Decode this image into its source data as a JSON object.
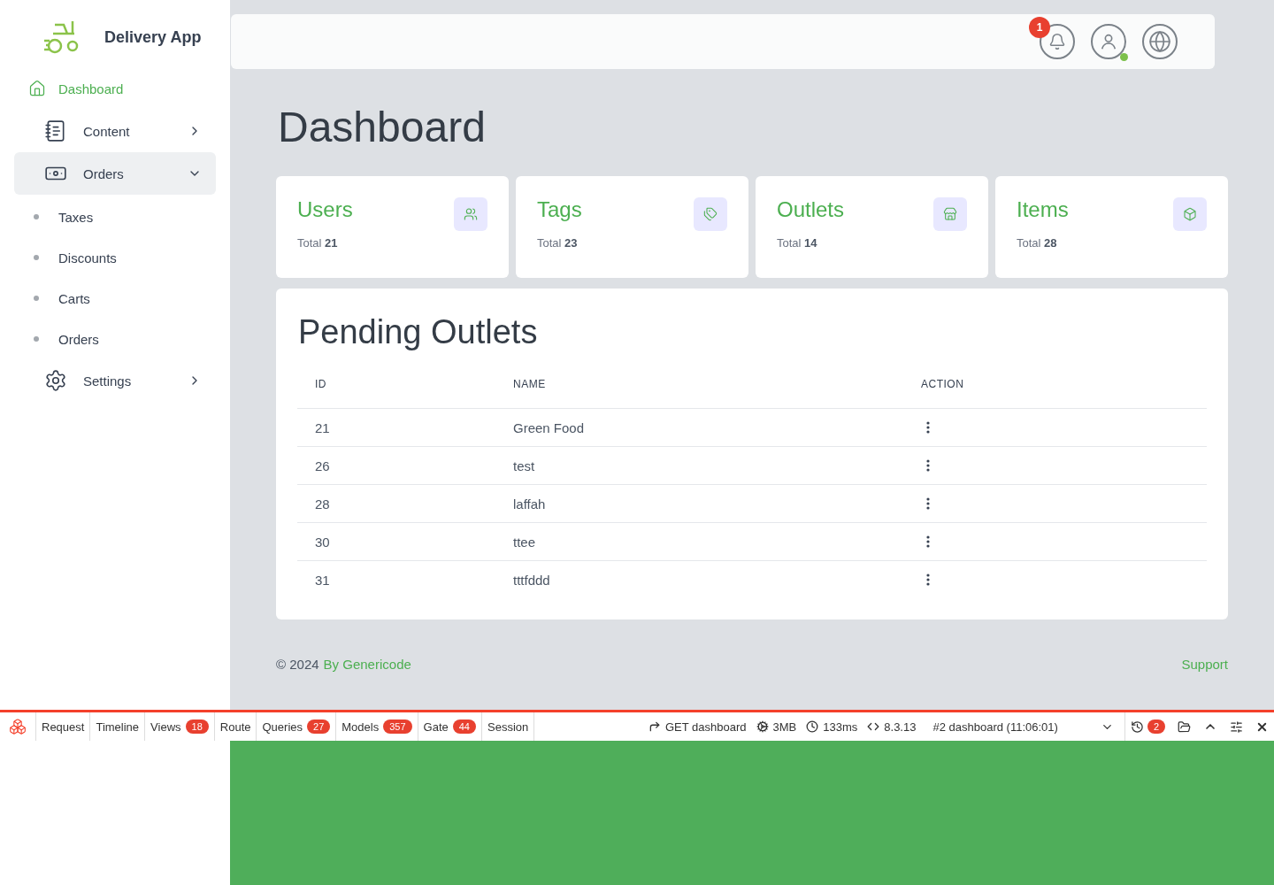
{
  "sidebar": {
    "brand": "Delivery App",
    "items": [
      {
        "kind": "link",
        "label": "Dashboard",
        "selected": true
      },
      {
        "kind": "group",
        "label": "Content",
        "selected": false,
        "expanded": false
      },
      {
        "kind": "group",
        "label": "Orders",
        "selected": false,
        "expanded": true,
        "children": [
          {
            "label": "Taxes",
            "selected": false
          },
          {
            "label": "Discounts",
            "selected": false
          },
          {
            "label": "Carts",
            "selected": false
          },
          {
            "label": "Orders",
            "selected": false
          }
        ]
      },
      {
        "kind": "group",
        "label": "Settings",
        "selected": false,
        "expanded": false
      }
    ]
  },
  "header": {
    "notification_count": "1",
    "user_online": true
  },
  "page_title": "Dashboard",
  "stats": [
    {
      "title": "Users",
      "total": "Total **21**"
    },
    {
      "title": "Tags",
      "total": "Total **23**"
    },
    {
      "title": "Outlets",
      "total": "Total **14**"
    },
    {
      "title": "Items",
      "total": "Total **28**"
    }
  ],
  "pending_outlets": {
    "title": "Pending Outlets",
    "columns": [
      "ID",
      "NAME",
      "ACTION"
    ],
    "rows": [
      {
        "id": "21",
        "name": "Green Food"
      },
      {
        "id": "26",
        "name": "test"
      },
      {
        "id": "28",
        "name": "laffah"
      },
      {
        "id": "30",
        "name": "ttee"
      },
      {
        "id": "31",
        "name": "tttfddd"
      }
    ]
  },
  "footer": {
    "copyright": "© 2024",
    "credit": "By Genericode",
    "support": "Support"
  },
  "debugbar": {
    "tabs": [
      {
        "label": "Request"
      },
      {
        "label": "Timeline"
      },
      {
        "label": "Views",
        "count": "18"
      },
      {
        "label": "Route"
      },
      {
        "label": "Queries",
        "count": "27"
      },
      {
        "label": "Models",
        "count": "357"
      },
      {
        "label": "Gate",
        "count": "44"
      },
      {
        "label": "Session"
      }
    ],
    "info": [
      {
        "kind": "route",
        "text": "GET dashboard"
      },
      {
        "kind": "memory",
        "text": "3MB"
      },
      {
        "kind": "time",
        "text": "133ms"
      },
      {
        "kind": "version",
        "text": "8.3.13"
      }
    ],
    "request": "#2 dashboard (11:06:01)",
    "history_count": "2"
  }
}
